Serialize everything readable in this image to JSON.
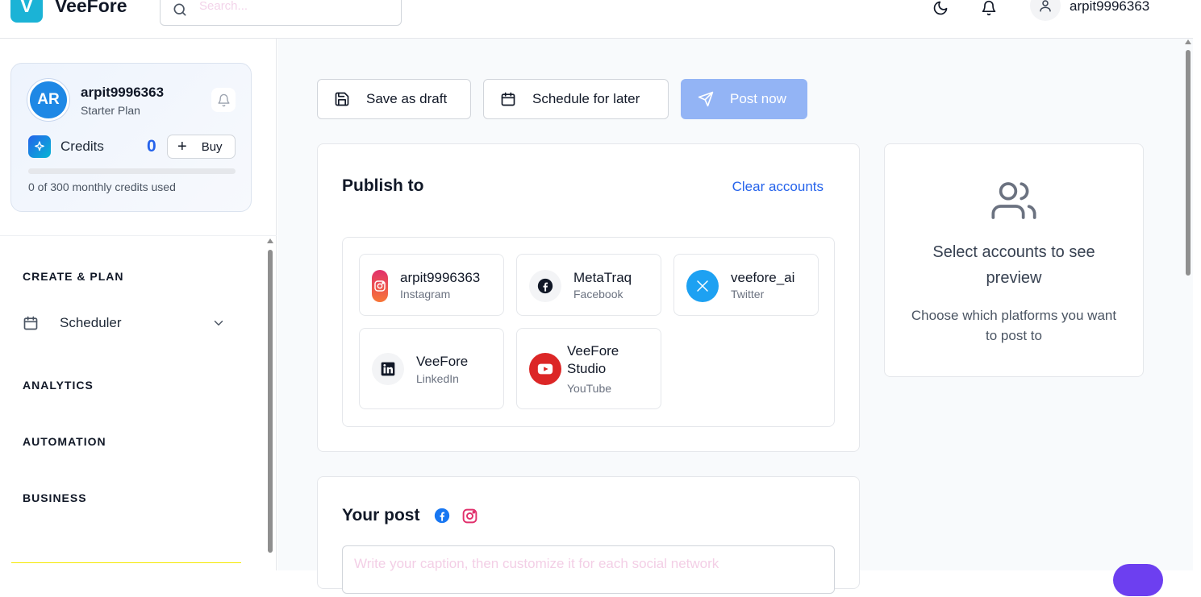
{
  "app": {
    "logo_letter": "V",
    "name": "VeeFore"
  },
  "topbar": {
    "search_placeholder": "Search...",
    "user_name": "arpit9996363"
  },
  "profile": {
    "initials": "AR",
    "name": "arpit9996363",
    "plan": "Starter Plan",
    "credits_label": "Credits",
    "credits_count": "0",
    "buy_label": "Buy",
    "usage_text": "0 of 300 monthly credits used",
    "usage_fraction": 0
  },
  "sidebar": {
    "sections": {
      "create_plan": "CREATE & PLAN",
      "analytics": "ANALYTICS",
      "automation": "AUTOMATION",
      "business": "BUSINESS"
    },
    "scheduler_label": "Scheduler"
  },
  "actions": {
    "save_draft": "Save as draft",
    "schedule_later": "Schedule for later",
    "post_now": "Post now"
  },
  "publish": {
    "title": "Publish to",
    "clear_label": "Clear accounts",
    "accounts": [
      {
        "name": "arpit9996363",
        "platform": "Instagram",
        "icon": "instagram-icon"
      },
      {
        "name": "MetaTraq",
        "platform": "Facebook",
        "icon": "facebook-icon"
      },
      {
        "name": "veefore_ai",
        "platform": "Twitter",
        "icon": "x-twitter-icon"
      },
      {
        "name": "VeeFore",
        "platform": "LinkedIn",
        "icon": "linkedin-icon"
      },
      {
        "name": "VeeFore Studio",
        "platform": "YouTube",
        "icon": "youtube-icon"
      }
    ]
  },
  "preview": {
    "title": "Select accounts to see preview",
    "subtitle": "Choose which platforms you want to post to"
  },
  "post": {
    "title": "Your post",
    "caption_placeholder": "Write your caption, then customize it for each social network"
  },
  "colors": {
    "brand": "#1bb3d6",
    "accent": "#2563eb",
    "primary_button_disabled": "#93b4f5",
    "instagram": "#e1306c",
    "facebook": "#1877f2",
    "twitter": "#1da1f2",
    "youtube": "#dc2626"
  }
}
